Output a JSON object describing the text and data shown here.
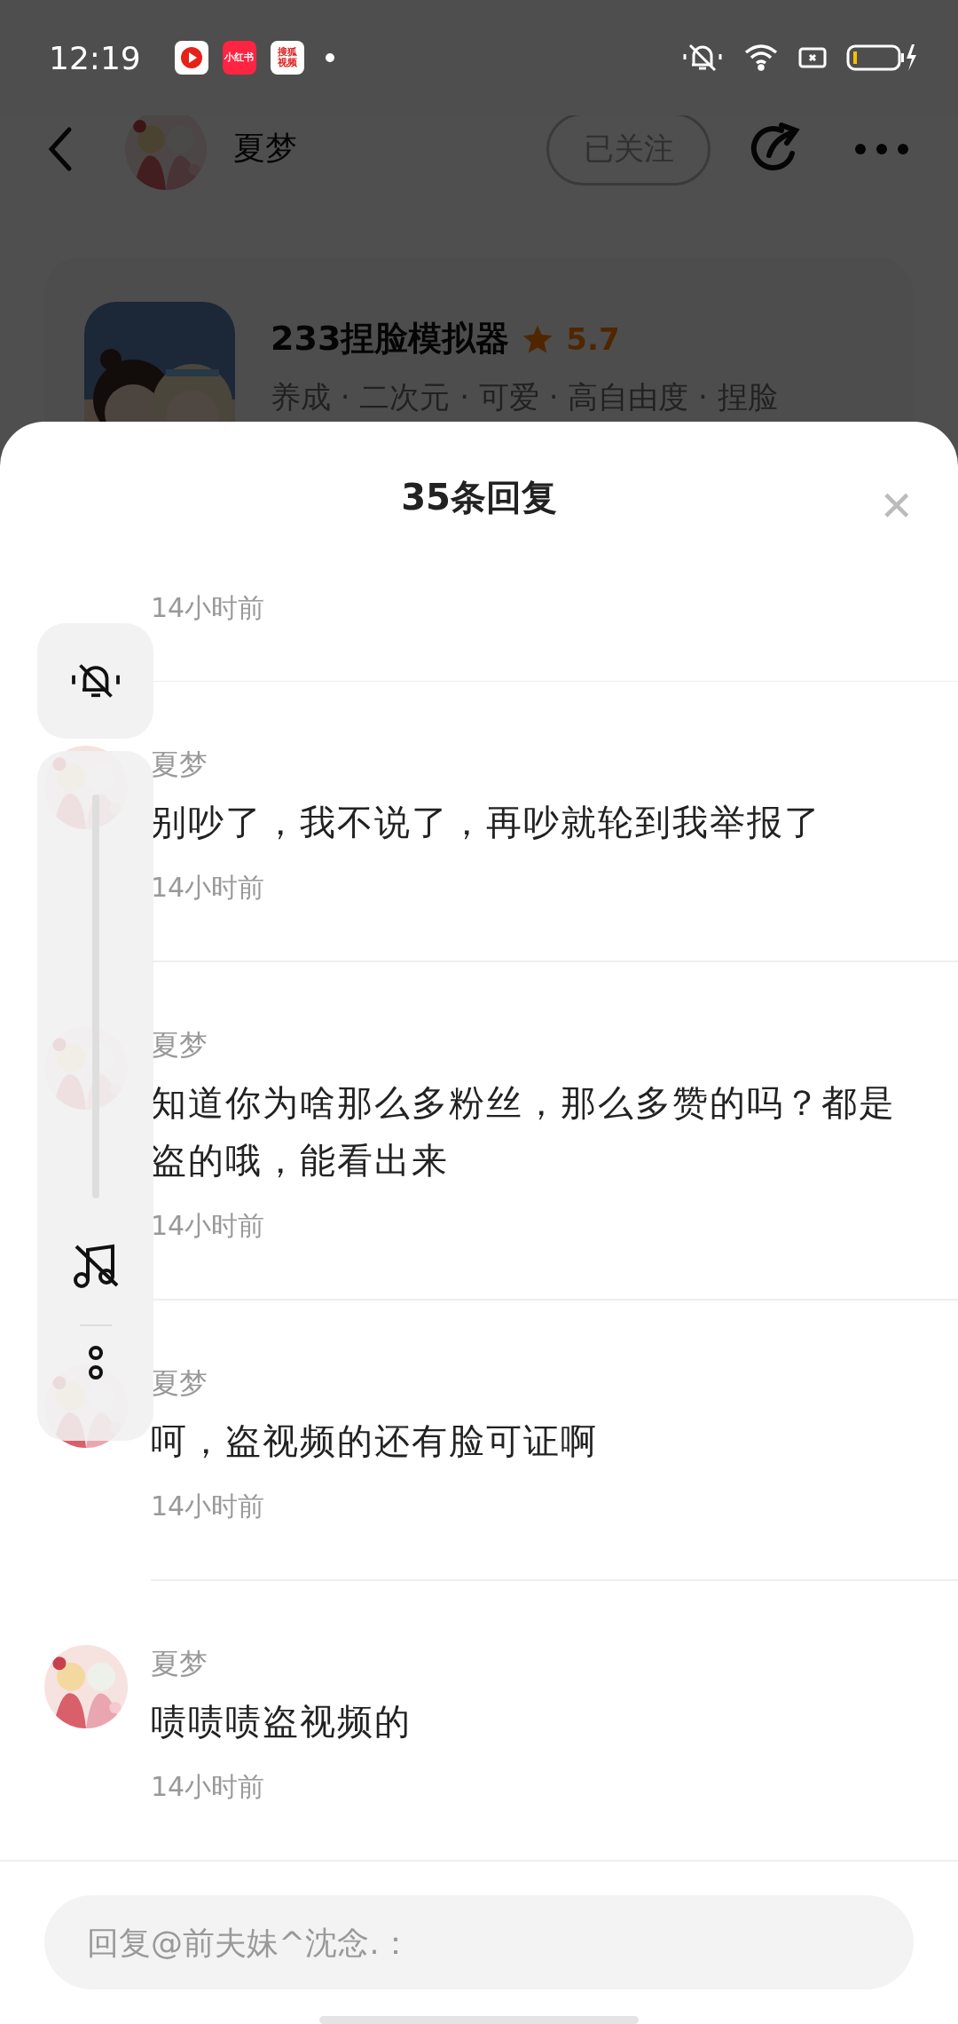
{
  "status_bar": {
    "time": "12:19",
    "notifications": [
      {
        "kind": "play"
      },
      {
        "kind": "label",
        "lines": [
          "小红书"
        ]
      },
      {
        "kind": "stacked",
        "lines": [
          "搜狐",
          "视频"
        ]
      },
      {
        "kind": "dot"
      }
    ]
  },
  "header": {
    "name": "夏梦",
    "follow_label": "已关注",
    "followed": true
  },
  "game": {
    "title": "233捏脸模拟器",
    "rating": "5.7",
    "tags": "养成 · 二次元 · 可爱 · 高自由度 · 捏脸"
  },
  "sheet": {
    "title": "35条回复",
    "close": "✕"
  },
  "replies": [
    {
      "time": "14小时前"
    },
    {
      "name": "夏梦",
      "text": "别吵了，我不说了，再吵就轮到我举报了",
      "time": "14小时前"
    },
    {
      "name": "夏梦",
      "text": "知道你为啥那么多粉丝，那么多赞的吗？都是盗的哦，能看出来",
      "time": "14小时前"
    },
    {
      "name": "夏梦",
      "text": "呵，盗视频的还有脸可证啊",
      "time": "14小时前"
    },
    {
      "name": "夏梦",
      "text": "啧啧啧盗视频的",
      "time": "14小时前"
    }
  ],
  "reply_box": {
    "placeholder": "回复@前夫妹^沈念.："
  }
}
